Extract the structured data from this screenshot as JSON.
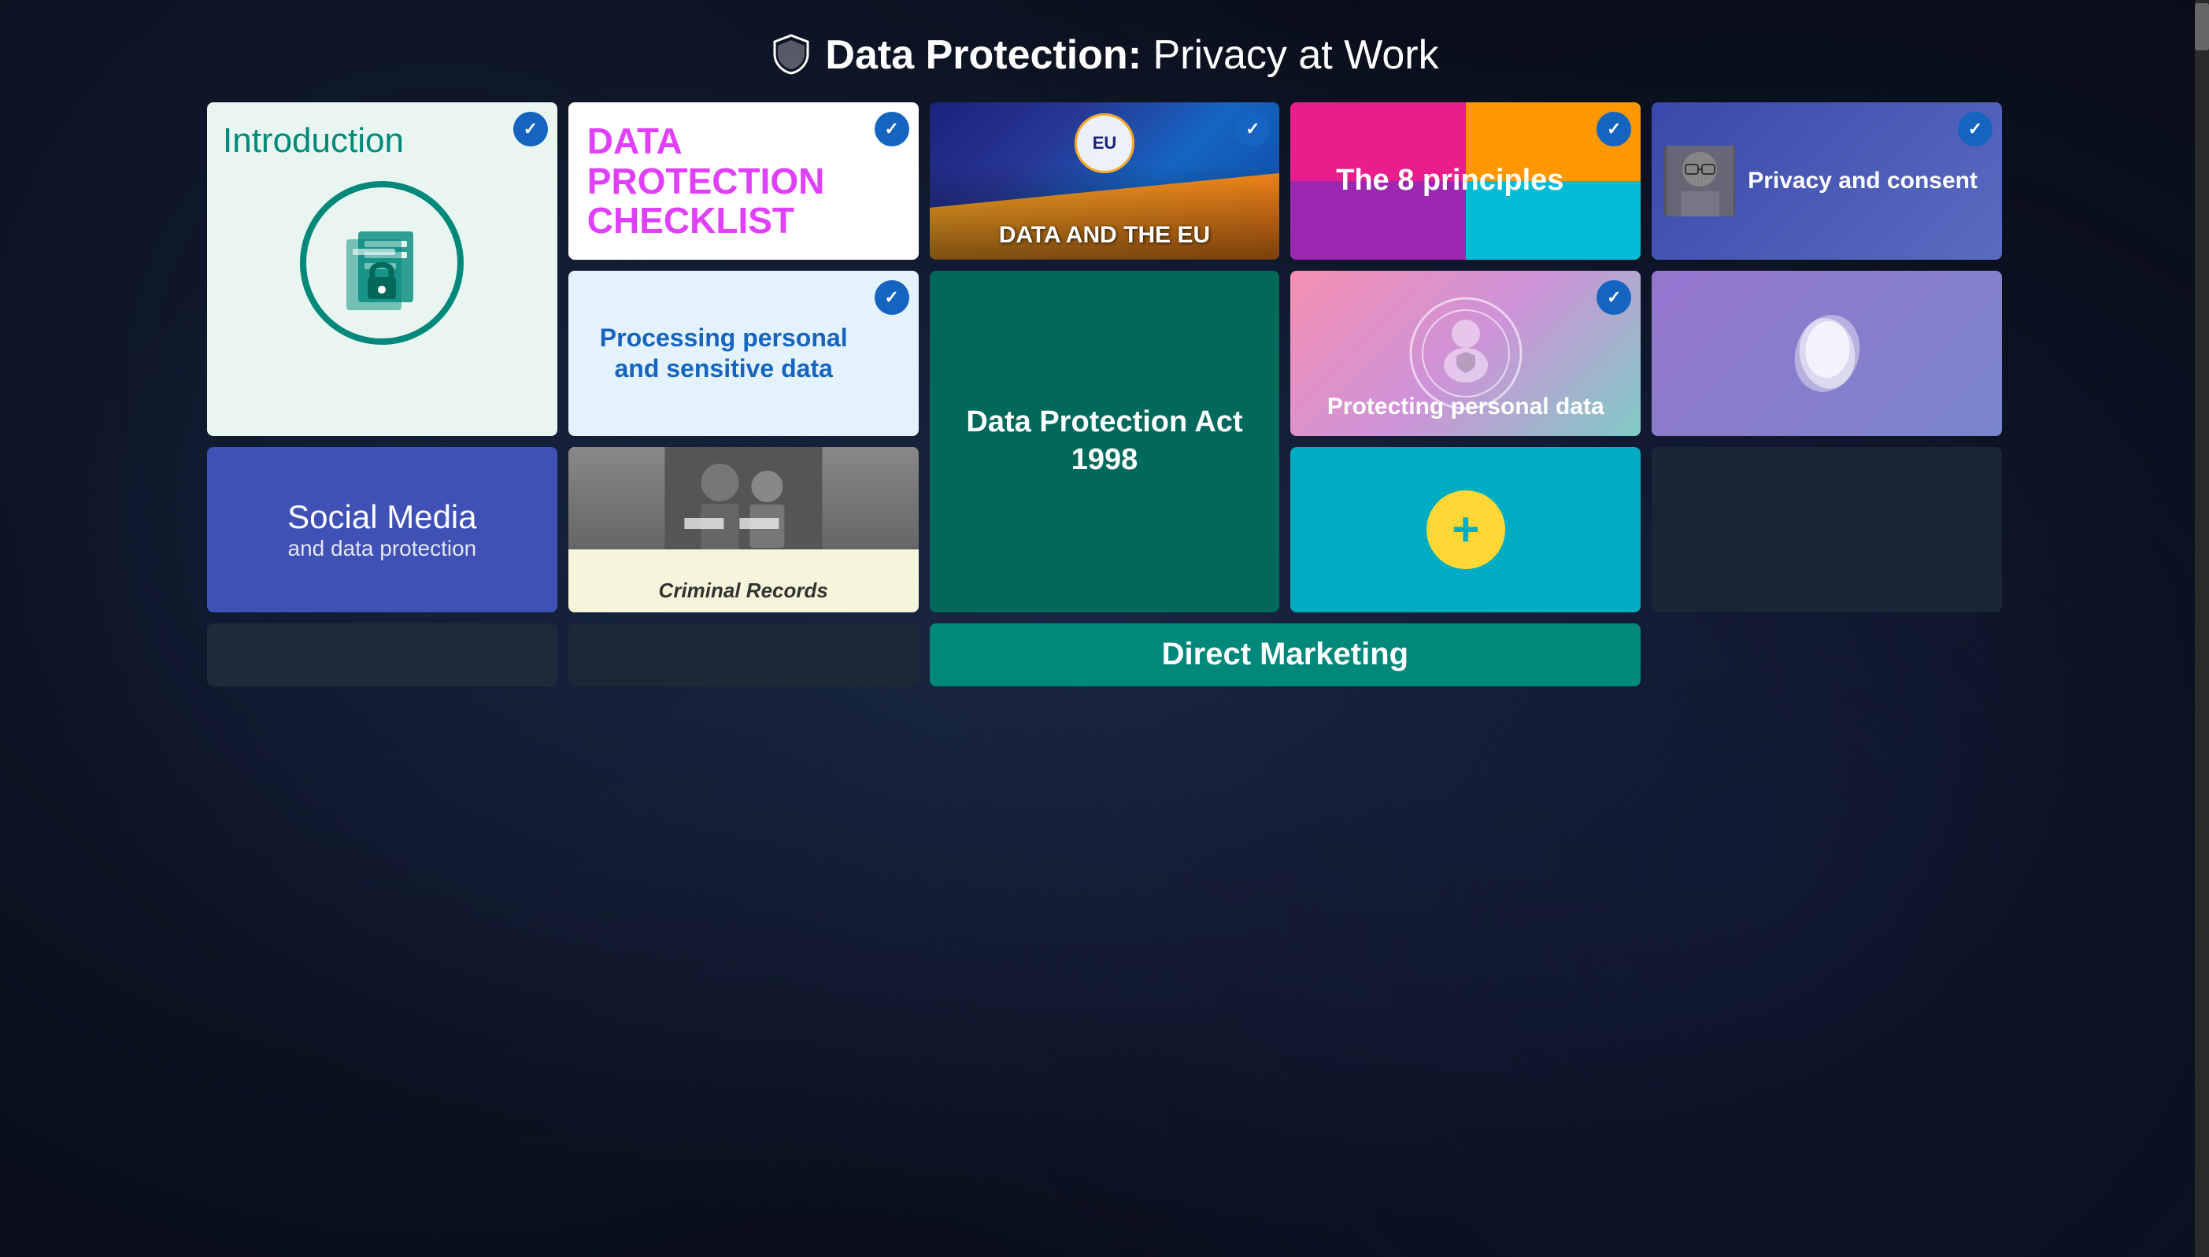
{
  "header": {
    "title_bold": "Data Protection:",
    "title_normal": " Privacy at Work",
    "shield_icon": "shield-icon"
  },
  "cards": {
    "introduction": {
      "title": "Introduction",
      "checked": true
    },
    "checklist": {
      "title": "DATA PROTECTION CHECKLIST",
      "checked": true
    },
    "eu": {
      "title": "DATA AND THE EU",
      "eu_label": "EU",
      "checked": true
    },
    "principles": {
      "title": "The 8 principles",
      "checked": true
    },
    "privacy": {
      "title": "Privacy and consent",
      "checked": true
    },
    "processing": {
      "title": "Processing personal and sensitive data",
      "checked": true
    },
    "dpa": {
      "title": "Data Protection Act 1998",
      "checked": false
    },
    "protecting": {
      "title": "Protecting personal data",
      "checked": true
    },
    "blob": {
      "title": "",
      "checked": false
    },
    "social": {
      "title": "Social Media",
      "subtitle": "and data protection",
      "checked": false
    },
    "criminal": {
      "title": "Criminal Records",
      "checked": false
    },
    "add": {
      "plus_label": "+",
      "checked": false
    },
    "direct": {
      "title": "Direct Marketing",
      "checked": false
    }
  },
  "colors": {
    "checked_badge": "#1565c0",
    "introduction_text": "#00897b",
    "checklist_text": "#e040fb",
    "principles_bg_start": "#e91e8c",
    "dpa_bg": "#00695c",
    "social_bg": "#3f51b5",
    "add_bg": "#00acc1",
    "add_circle": "#fdd835",
    "direct_bg": "#00897b"
  }
}
